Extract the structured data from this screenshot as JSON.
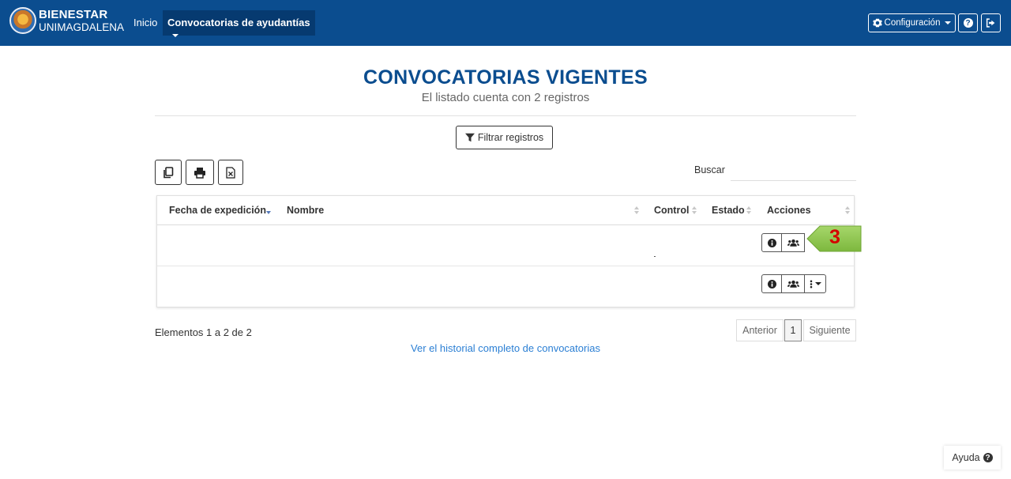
{
  "navbar": {
    "brand_line1": "BIENESTAR",
    "brand_line2": "UNIMAGDALENA",
    "inicio": "Inicio",
    "convocatorias_menu": "Convocatorias de ayudantías",
    "config_label": "Configuración",
    "color": "#0b4d8f"
  },
  "page": {
    "title": "CONVOCATORIAS VIGENTES",
    "subtitle": "El listado cuenta con 2 registros",
    "filter_button": "Filtrar registros",
    "search_label": "Buscar",
    "search_value": ""
  },
  "toolbar": {
    "icons": [
      "copy-icon",
      "print-icon",
      "excel-icon"
    ]
  },
  "table": {
    "columns": [
      "Fecha de expedición",
      "Nombre",
      "Control",
      "Estado",
      "Acciones"
    ],
    "sorted_column": "Fecha de expedición"
  },
  "footer": {
    "info": "Elementos 1 a 2 de 2",
    "prev": "Anterior",
    "page": "1",
    "next": "Siguiente",
    "history_link": "Ver el historial completo de convocatorias"
  },
  "callout": {
    "number": "3",
    "color": "#8bc34a"
  },
  "help": {
    "label": "Ayuda"
  }
}
